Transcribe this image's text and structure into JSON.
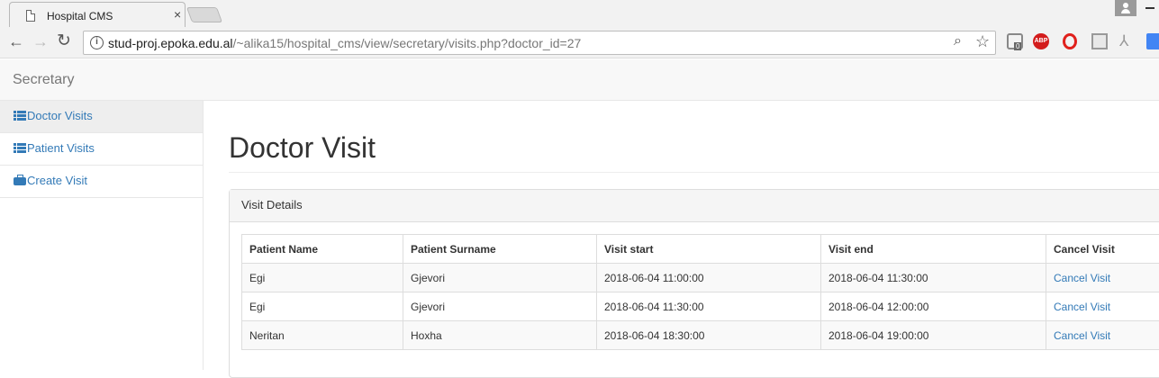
{
  "browser": {
    "tab_title": "Hospital CMS",
    "tab_close": "×",
    "url_host": "stud-proj.epoka.edu.al",
    "url_path": "/~alika15/hospital_cms/view/secretary/visits.php?doctor_id=27",
    "ext_badge": "0",
    "abp_label": "ABP"
  },
  "navbar": {
    "brand": "Secretary"
  },
  "sidebar": {
    "items": [
      {
        "label": "Doctor Visits",
        "icon": "list-icon",
        "active": true
      },
      {
        "label": "Patient Visits",
        "icon": "list-icon",
        "active": false
      },
      {
        "label": "Create Visit",
        "icon": "briefcase-icon",
        "active": false
      }
    ]
  },
  "main": {
    "title": "Doctor Visit",
    "panel_heading": "Visit Details",
    "table": {
      "headers": [
        "Patient Name",
        "Patient Surname",
        "Visit start",
        "Visit end",
        "Cancel Visit"
      ],
      "rows": [
        [
          "Egi",
          "Gjevori",
          "2018-06-04 11:00:00",
          "2018-06-04 11:30:00",
          "Cancel Visit"
        ],
        [
          "Egi",
          "Gjevori",
          "2018-06-04 11:30:00",
          "2018-06-04 12:00:00",
          "Cancel Visit"
        ],
        [
          "Neritan",
          "Hoxha",
          "2018-06-04 18:30:00",
          "2018-06-04 19:00:00",
          "Cancel Visit"
        ]
      ]
    }
  },
  "colors": {
    "link": "#337ab7",
    "navbar_bg": "#f8f8f8",
    "active_item_bg": "#eeeeee"
  }
}
